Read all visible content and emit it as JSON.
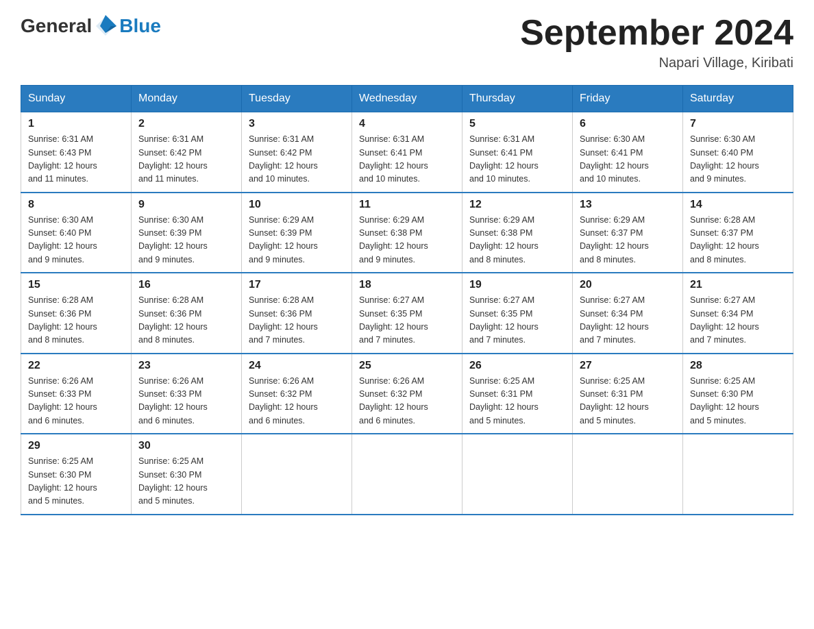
{
  "header": {
    "logo": {
      "text_general": "General",
      "text_blue": "Blue"
    },
    "title": "September 2024",
    "location": "Napari Village, Kiribati"
  },
  "calendar": {
    "days_of_week": [
      "Sunday",
      "Monday",
      "Tuesday",
      "Wednesday",
      "Thursday",
      "Friday",
      "Saturday"
    ],
    "weeks": [
      [
        {
          "day": "1",
          "sunrise": "6:31 AM",
          "sunset": "6:43 PM",
          "daylight": "12 hours and 11 minutes."
        },
        {
          "day": "2",
          "sunrise": "6:31 AM",
          "sunset": "6:42 PM",
          "daylight": "12 hours and 11 minutes."
        },
        {
          "day": "3",
          "sunrise": "6:31 AM",
          "sunset": "6:42 PM",
          "daylight": "12 hours and 10 minutes."
        },
        {
          "day": "4",
          "sunrise": "6:31 AM",
          "sunset": "6:41 PM",
          "daylight": "12 hours and 10 minutes."
        },
        {
          "day": "5",
          "sunrise": "6:31 AM",
          "sunset": "6:41 PM",
          "daylight": "12 hours and 10 minutes."
        },
        {
          "day": "6",
          "sunrise": "6:30 AM",
          "sunset": "6:41 PM",
          "daylight": "12 hours and 10 minutes."
        },
        {
          "day": "7",
          "sunrise": "6:30 AM",
          "sunset": "6:40 PM",
          "daylight": "12 hours and 9 minutes."
        }
      ],
      [
        {
          "day": "8",
          "sunrise": "6:30 AM",
          "sunset": "6:40 PM",
          "daylight": "12 hours and 9 minutes."
        },
        {
          "day": "9",
          "sunrise": "6:30 AM",
          "sunset": "6:39 PM",
          "daylight": "12 hours and 9 minutes."
        },
        {
          "day": "10",
          "sunrise": "6:29 AM",
          "sunset": "6:39 PM",
          "daylight": "12 hours and 9 minutes."
        },
        {
          "day": "11",
          "sunrise": "6:29 AM",
          "sunset": "6:38 PM",
          "daylight": "12 hours and 9 minutes."
        },
        {
          "day": "12",
          "sunrise": "6:29 AM",
          "sunset": "6:38 PM",
          "daylight": "12 hours and 8 minutes."
        },
        {
          "day": "13",
          "sunrise": "6:29 AM",
          "sunset": "6:37 PM",
          "daylight": "12 hours and 8 minutes."
        },
        {
          "day": "14",
          "sunrise": "6:28 AM",
          "sunset": "6:37 PM",
          "daylight": "12 hours and 8 minutes."
        }
      ],
      [
        {
          "day": "15",
          "sunrise": "6:28 AM",
          "sunset": "6:36 PM",
          "daylight": "12 hours and 8 minutes."
        },
        {
          "day": "16",
          "sunrise": "6:28 AM",
          "sunset": "6:36 PM",
          "daylight": "12 hours and 8 minutes."
        },
        {
          "day": "17",
          "sunrise": "6:28 AM",
          "sunset": "6:36 PM",
          "daylight": "12 hours and 7 minutes."
        },
        {
          "day": "18",
          "sunrise": "6:27 AM",
          "sunset": "6:35 PM",
          "daylight": "12 hours and 7 minutes."
        },
        {
          "day": "19",
          "sunrise": "6:27 AM",
          "sunset": "6:35 PM",
          "daylight": "12 hours and 7 minutes."
        },
        {
          "day": "20",
          "sunrise": "6:27 AM",
          "sunset": "6:34 PM",
          "daylight": "12 hours and 7 minutes."
        },
        {
          "day": "21",
          "sunrise": "6:27 AM",
          "sunset": "6:34 PM",
          "daylight": "12 hours and 7 minutes."
        }
      ],
      [
        {
          "day": "22",
          "sunrise": "6:26 AM",
          "sunset": "6:33 PM",
          "daylight": "12 hours and 6 minutes."
        },
        {
          "day": "23",
          "sunrise": "6:26 AM",
          "sunset": "6:33 PM",
          "daylight": "12 hours and 6 minutes."
        },
        {
          "day": "24",
          "sunrise": "6:26 AM",
          "sunset": "6:32 PM",
          "daylight": "12 hours and 6 minutes."
        },
        {
          "day": "25",
          "sunrise": "6:26 AM",
          "sunset": "6:32 PM",
          "daylight": "12 hours and 6 minutes."
        },
        {
          "day": "26",
          "sunrise": "6:25 AM",
          "sunset": "6:31 PM",
          "daylight": "12 hours and 5 minutes."
        },
        {
          "day": "27",
          "sunrise": "6:25 AM",
          "sunset": "6:31 PM",
          "daylight": "12 hours and 5 minutes."
        },
        {
          "day": "28",
          "sunrise": "6:25 AM",
          "sunset": "6:30 PM",
          "daylight": "12 hours and 5 minutes."
        }
      ],
      [
        {
          "day": "29",
          "sunrise": "6:25 AM",
          "sunset": "6:30 PM",
          "daylight": "12 hours and 5 minutes."
        },
        {
          "day": "30",
          "sunrise": "6:25 AM",
          "sunset": "6:30 PM",
          "daylight": "12 hours and 5 minutes."
        },
        null,
        null,
        null,
        null,
        null
      ]
    ]
  }
}
